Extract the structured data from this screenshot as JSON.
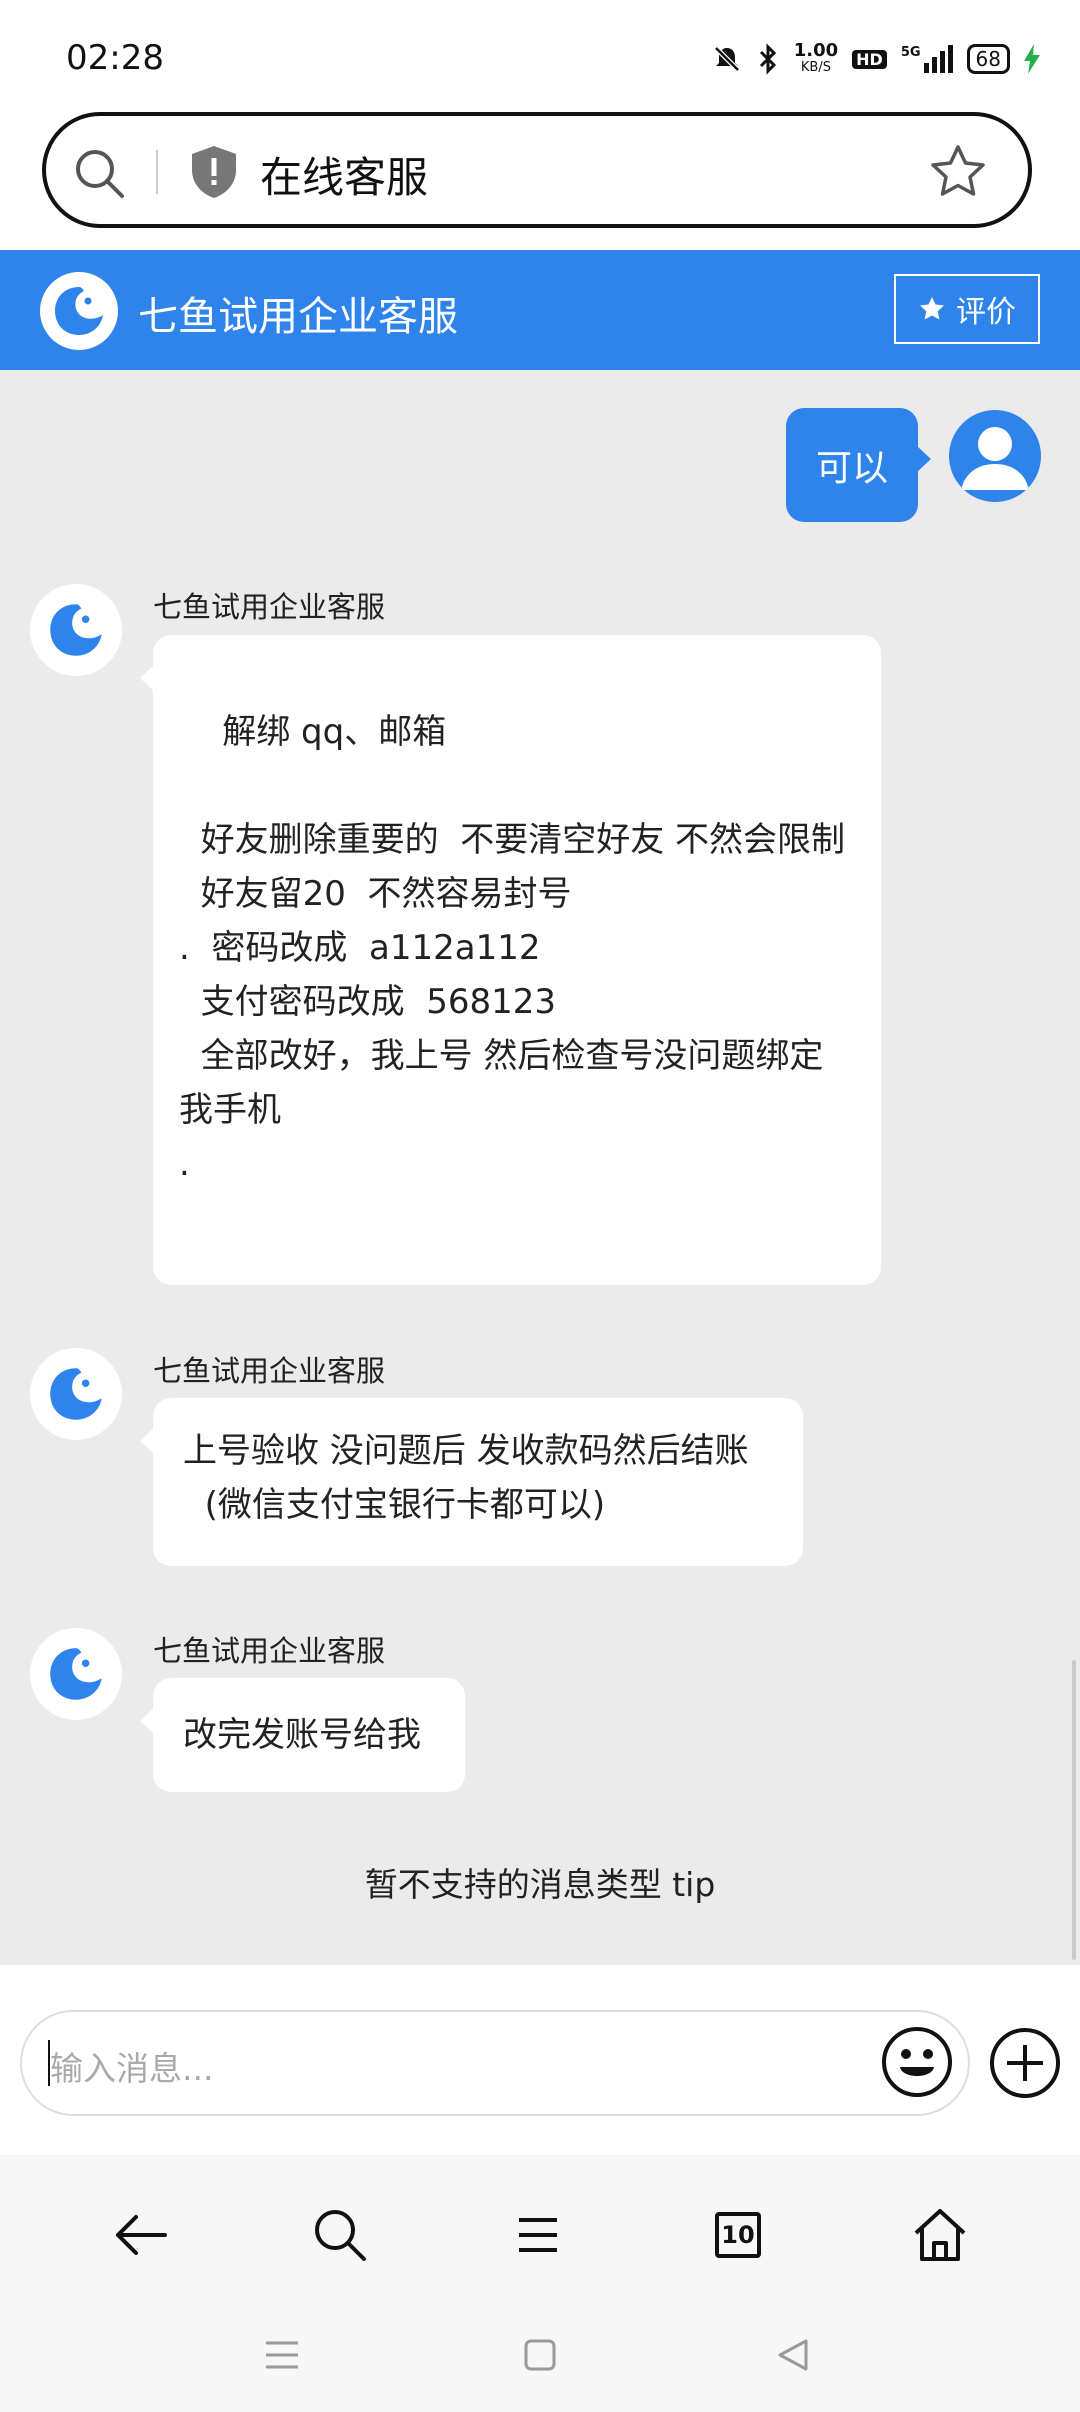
{
  "status_bar": {
    "time": "02:28",
    "net_speed_top": "1.00",
    "net_speed_unit": "KB/S",
    "hd_label": "HD",
    "signal_label": "5G",
    "battery": "68"
  },
  "url_bar": {
    "title": "在线客服"
  },
  "header": {
    "name": "七鱼试用企业客服",
    "rate_label": "评价"
  },
  "messages": {
    "user_1": "可以",
    "bot_1": {
      "sender": "七鱼试用企业客服",
      "text": "\n    解绑 qq、邮箱\n\n  好友删除重要的  不要清空好友 不然会限制\n  好友留20  不然容易封号\n.  密码改成  a112a112\n  支付密码改成  568123\n  全部改好，我上号 然后检查号没问题绑定我手机\n."
    },
    "bot_2": {
      "sender": "七鱼试用企业客服",
      "text": "上号验收 没问题后 发收款码然后结账\n  (微信支付宝银行卡都可以)"
    },
    "bot_3": {
      "sender": "七鱼试用企业客服",
      "text": "改完发账号给我"
    },
    "tip": "暂不支持的消息类型 tip"
  },
  "input": {
    "placeholder": "输入消息..."
  },
  "bottom_nav": {
    "tabs_count": "10"
  },
  "colors": {
    "accent": "#2f84ec",
    "background": "#ebebeb"
  }
}
